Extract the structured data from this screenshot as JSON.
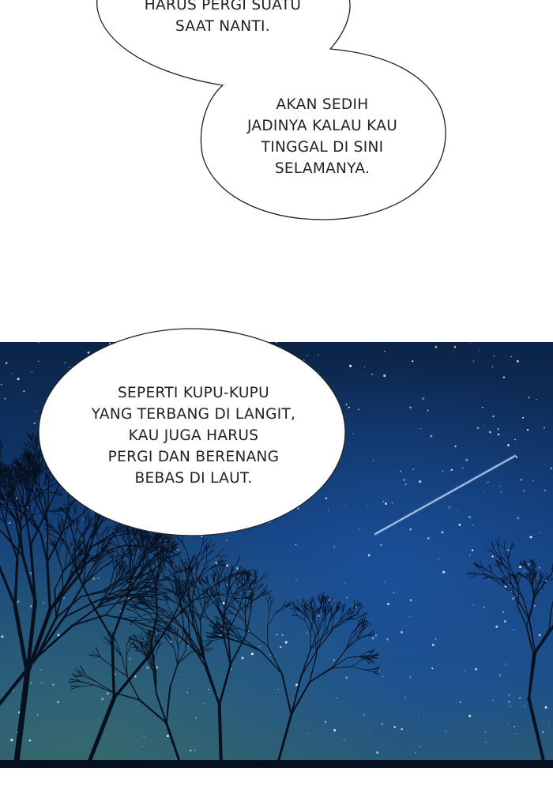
{
  "bubbles": {
    "first": "HARUS PERGI SUATU\nSAAT NANTI.",
    "second": "AKAN SEDIH\nJADINYA KALAU KAU\nTINGGAL DI SINI\nSELAMANYA.",
    "third": "SEPERTI KUPU-KUPU\nYANG TERBANG DI LANGIT,\nKAU JUGA HARUS\nPERGI DAN BERENANG\nBEBAS DI LAUT."
  },
  "colors": {
    "bubble_fill": "#ffffff",
    "bubble_stroke": "#222222",
    "sky_top": "#0c2447",
    "sky_mid": "#123d7a",
    "sky_horizon": "#2a5a73",
    "trees": "#06101e"
  },
  "scene": {
    "elements": [
      "night-sky",
      "stars",
      "shooting-star",
      "bare-tree-silhouettes"
    ]
  }
}
